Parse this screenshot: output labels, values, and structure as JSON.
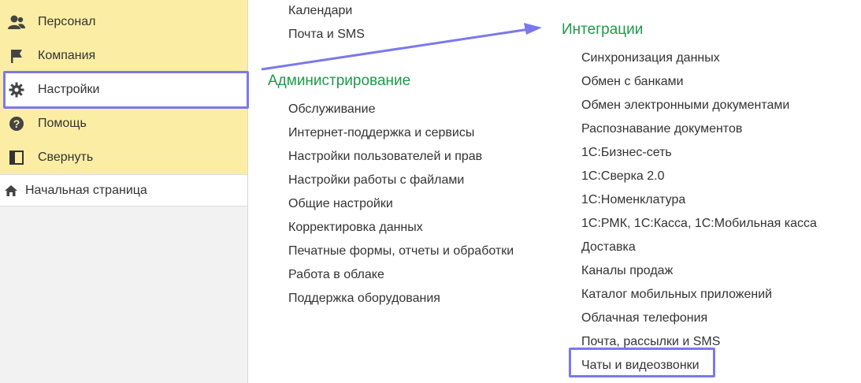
{
  "sidebar": {
    "items": [
      {
        "label": "Персонал",
        "icon": "people-icon"
      },
      {
        "label": "Компания",
        "icon": "flag-icon"
      },
      {
        "label": "Настройки",
        "icon": "gear-icon",
        "selected": true
      },
      {
        "label": "Помощь",
        "icon": "help-icon"
      },
      {
        "label": "Свернуть",
        "icon": "collapse-panel-icon"
      }
    ],
    "home": {
      "label": "Начальная страница",
      "icon": "home-icon"
    }
  },
  "content": {
    "top_links": [
      "Календари",
      "Почта и SMS"
    ],
    "administration": {
      "title": "Администрирование",
      "items": [
        "Обслуживание",
        "Интернет-поддержка и сервисы",
        "Настройки пользователей и прав",
        "Настройки работы с файлами",
        "Общие настройки",
        "Корректировка данных",
        "Печатные формы, отчеты и обработки",
        "Работа в облаке",
        "Поддержка оборудования"
      ]
    },
    "integrations": {
      "title": "Интеграции",
      "items": [
        "Синхронизация данных",
        "Обмен с банками",
        "Обмен электронными документами",
        "Распознавание документов",
        "1С:Бизнес-сеть",
        "1С:Сверка 2.0",
        "1С:Номенклатура",
        "1С:РМК, 1С:Касса, 1С:Мобильная касса",
        "Доставка",
        "Каналы продаж",
        "Каталог мобильных приложений",
        "Облачная телефония",
        "Почта, рассылки и SMS",
        "Чаты и видеозвонки"
      ]
    }
  },
  "colors": {
    "sidebar_yellow": "#fbeda4",
    "section_green": "#1c9a4a",
    "highlight": "#7b78ee"
  }
}
